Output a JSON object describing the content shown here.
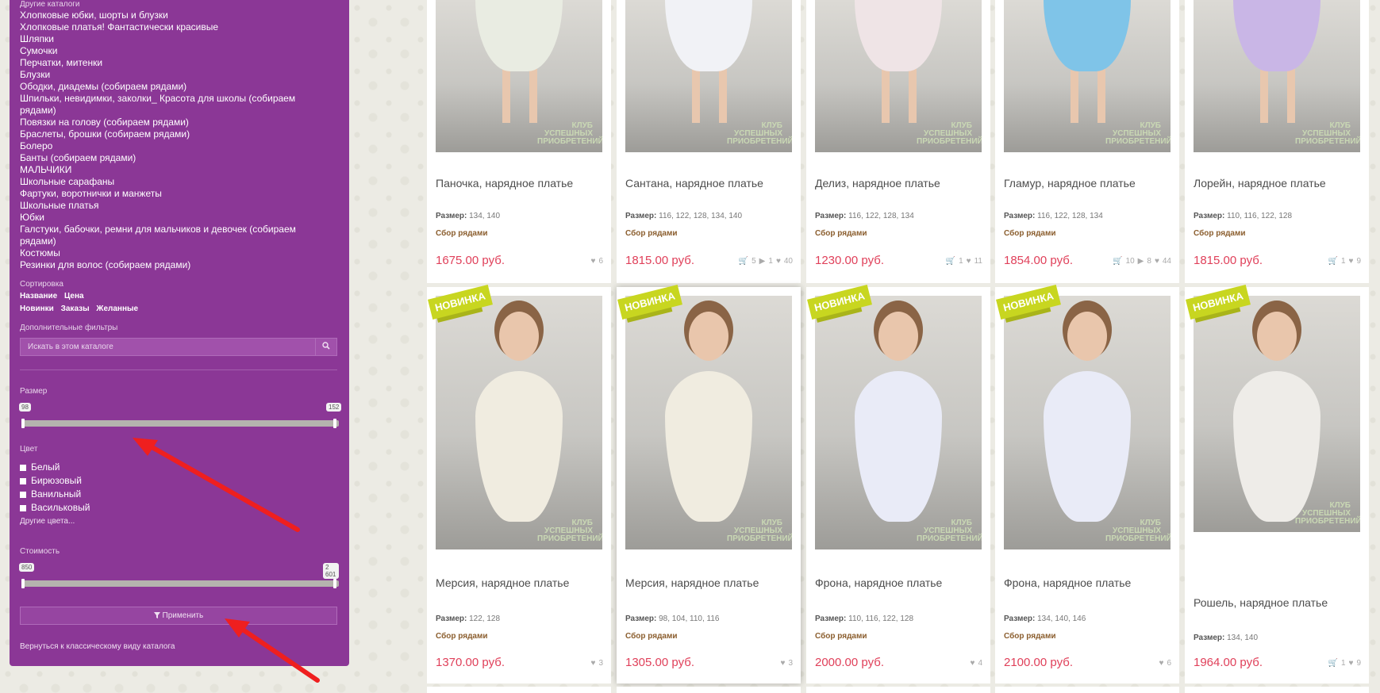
{
  "sidebar": {
    "other_catalogs_title": "Другие каталоги",
    "catalogs": [
      "Хлопковые юбки, шорты и блузки",
      "Хлопковые платья! Фантастически красивые",
      "Шляпки",
      "Сумочки",
      "Перчатки, митенки",
      "Блузки",
      "Ободки, диадемы (собираем рядами)",
      "Шпильки, невидимки, заколки_ Красота для школы (собираем рядами)",
      "Повязки на голову (собираем рядами)",
      "Браслеты, брошки (собираем рядами)",
      "Болеро",
      "Банты (собираем рядами)",
      "МАЛЬЧИКИ",
      "Школьные сарафаны",
      "Фартуки, воротнички и манжеты",
      "Школьные платья",
      "Юбки",
      "Галстуки, бабочки, ремни для мальчиков и девочек (собираем рядами)",
      "Костюмы",
      "Резинки для волос (собираем рядами)"
    ],
    "sort_title": "Сортировка",
    "sort_options": [
      "Название",
      "Цена",
      "Новинки",
      "Заказы",
      "Желанные"
    ],
    "extra_filters_title": "Дополнительные фильтры",
    "search_placeholder": "Искать в этом каталоге",
    "size_title": "Размер",
    "size_min": "98",
    "size_max": "152",
    "color_title": "Цвет",
    "colors": [
      "Белый",
      "Бирюзовый",
      "Ванильный",
      "Васильковый"
    ],
    "more_colors": "Другие цвета...",
    "cost_title": "Стоимость",
    "cost_min": "850",
    "cost_max": "2 601",
    "apply_label": "Применить",
    "classic_view_link": "Вернуться к классическому виду каталога"
  },
  "badge_text": "НОВИНКА",
  "watermark": "КЛУБ УСПЕШНЫХ ПРИОБРЕТЕНИЙ",
  "size_label": "Размер:",
  "collect_label": "Сбор рядами",
  "products": [
    {
      "name": "Паночка, нарядное платье",
      "sizes": "134, 140",
      "price": "1675.00 руб.",
      "cart": "",
      "comments": "",
      "likes": "6",
      "dress": "#e9ece2"
    },
    {
      "name": "Сантана, нарядное платье",
      "sizes": "116, 122, 128, 134, 140",
      "price": "1815.00 руб.",
      "cart": "5",
      "comments": "1",
      "likes": "40",
      "dress": "#f1f2f6"
    },
    {
      "name": "Делиз, нарядное платье",
      "sizes": "116, 122, 128, 134",
      "price": "1230.00 руб.",
      "cart": "",
      "comments": "",
      "likes": "1",
      "likes2": "11",
      "dress": "#efe4e6"
    },
    {
      "name": "Гламур, нарядное платье",
      "sizes": "116, 122, 128, 134",
      "price": "1854.00 руб.",
      "cart": "10",
      "comments": "8",
      "likes": "44",
      "dress": "#7fc4e8"
    },
    {
      "name": "Лорейн, нарядное платье",
      "sizes": "110, 116, 122, 128",
      "price": "1815.00 руб.",
      "cart": "1",
      "comments": "",
      "likes": "9",
      "dress": "#c9b6e6"
    },
    {
      "name": "Мерсия, нарядное платье",
      "sizes": "122, 128",
      "price": "1370.00 руб.",
      "cart": "",
      "comments": "",
      "likes": "3",
      "dress": "#f0ece0"
    },
    {
      "name": "Мерсия, нарядное платье",
      "sizes": "98, 104, 110, 116",
      "price": "1305.00 руб.",
      "cart": "",
      "comments": "",
      "likes": "3",
      "dress": "#f0ece0"
    },
    {
      "name": "Фрона, нарядное платье",
      "sizes": "110, 116, 122, 128",
      "price": "2000.00 руб.",
      "cart": "",
      "comments": "",
      "likes": "4",
      "dress": "#e9ebf7"
    },
    {
      "name": "Фрона, нарядное платье",
      "sizes": "134, 140, 146",
      "price": "2100.00 руб.",
      "cart": "",
      "comments": "",
      "likes": "6",
      "dress": "#e9ebf7"
    },
    {
      "name": "Рошель, нарядное платье",
      "sizes": "134, 140",
      "price": "1964.00 руб.",
      "cart": "1",
      "comments": "",
      "likes": "9",
      "dress": "#eeece8"
    }
  ]
}
